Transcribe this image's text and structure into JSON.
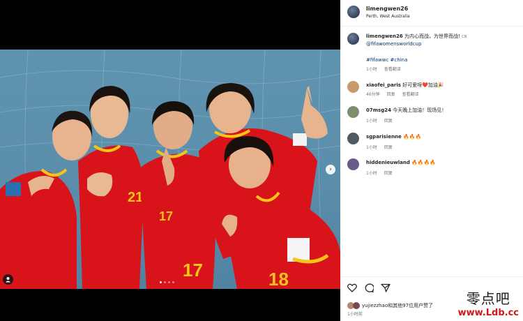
{
  "post": {
    "username": "limengwen26",
    "location": "Perth, West Australia"
  },
  "caption": {
    "username": "limengwen26",
    "text": "为内心而战，为世界而战!",
    "lang": "CN",
    "mention": "@fifawomensworldcup",
    "hashtags": "#fifawwc #china",
    "time": "1小时",
    "see_translation": "查看翻译"
  },
  "comments": [
    {
      "username": "xiaofei_paris",
      "text": "好可爱呀❤️加油🎉",
      "time": "46分钟",
      "reply": "回复",
      "see_translation": "查看翻译",
      "avatar_color": "#c99a6a"
    },
    {
      "username": "07msg24",
      "text": "今天晚上加油！现场见！",
      "time": "1小时",
      "reply": "回复",
      "see_translation": "",
      "avatar_color": "#7d8f6a"
    },
    {
      "username": "sgparisienne",
      "text": "🔥🔥🔥",
      "time": "1小时",
      "reply": "回复",
      "see_translation": "",
      "avatar_color": "#4e5a63"
    },
    {
      "username": "hiddenieuwland",
      "text": "🔥🔥🔥🔥",
      "time": "1小时",
      "reply": "回复",
      "see_translation": "",
      "avatar_color": "#6a5a8a"
    }
  ],
  "likes": {
    "text": "yujiezzhao和其他97位用户赞了",
    "time": "1小时前"
  },
  "icons": {
    "like": "heart-icon",
    "comment": "comment-icon",
    "share": "share-icon",
    "bookmark": "bookmark-icon",
    "next": "chevron-right-icon",
    "tags": "user-tag-icon"
  },
  "carousel": {
    "count": 4,
    "active": 0
  },
  "watermark": {
    "cn": "零点吧",
    "url": "www.Ldb.cc"
  },
  "colors": {
    "jersey": "#d8131a",
    "trim": "#f5c518",
    "backdrop": "#5f94b0"
  }
}
